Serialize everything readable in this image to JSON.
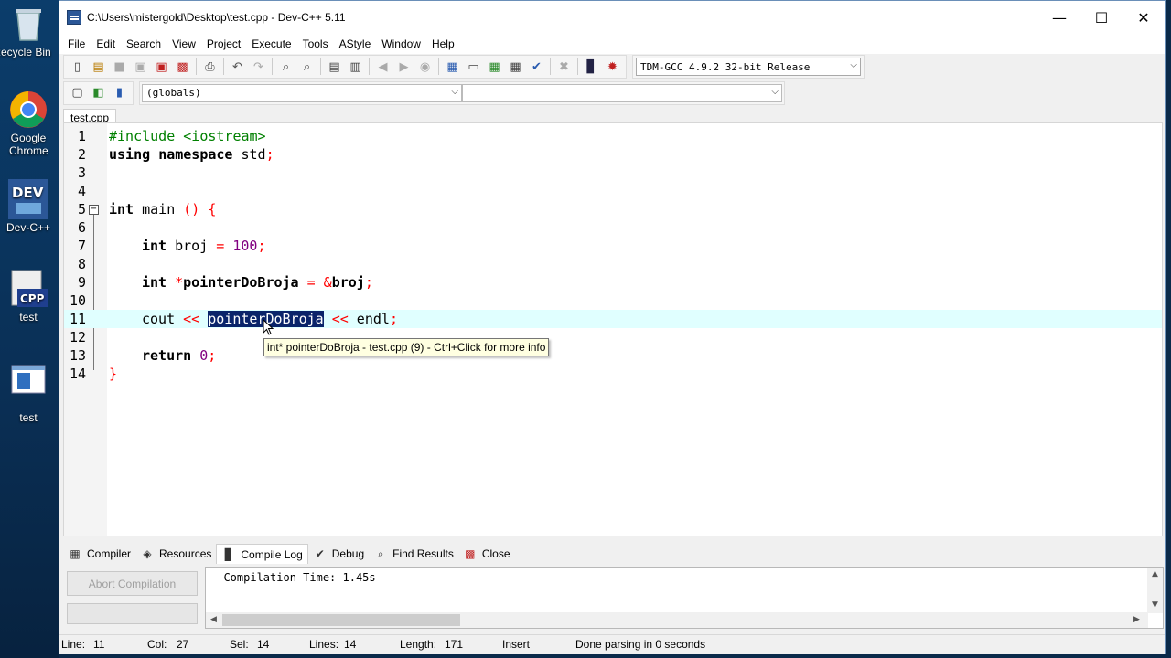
{
  "desktop": {
    "icons": [
      {
        "label": "Recycle Bin"
      },
      {
        "label": "Google Chrome"
      },
      {
        "label": "Dev-C++"
      },
      {
        "label": "test"
      },
      {
        "label": "test"
      }
    ]
  },
  "window": {
    "title": "C:\\Users\\mistergold\\Desktop\\test.cpp - Dev-C++ 5.11",
    "controls": {
      "minimize": "—",
      "maximize": "☐",
      "close": "✕"
    }
  },
  "menu": [
    "File",
    "Edit",
    "Search",
    "View",
    "Project",
    "Execute",
    "Tools",
    "AStyle",
    "Window",
    "Help"
  ],
  "toolbar": {
    "compiler_select": "TDM-GCC 4.9.2 32-bit Release",
    "scope_select": "(globals)",
    "member_select": ""
  },
  "file_tab": "test.cpp",
  "editor": {
    "line_numbers": [
      "1",
      "2",
      "3",
      "4",
      "5",
      "6",
      "7",
      "8",
      "9",
      "10",
      "11",
      "12",
      "13",
      "14"
    ],
    "line1": {
      "pp": "#include <iostream>"
    },
    "line2": {
      "kw1": "using",
      "kw2": "namespace",
      "txt": " std",
      "sym": ";"
    },
    "line5": {
      "kw": "int",
      "txt": " main ",
      "sym": "() {"
    },
    "line7": {
      "kw": "int",
      "txt": " broj ",
      "sym1": "=",
      "num": " 100",
      "sym2": ";"
    },
    "line9": {
      "kw": "int",
      "sym1": " *",
      "txt": "pointerDoBroja ",
      "sym2": "= &",
      "txt2": "broj",
      "sym3": ";"
    },
    "line11": {
      "txt1": "cout ",
      "sym1": "<<",
      "txt2": " ",
      "selected": "pointerDoBroja",
      "sym2": " <<",
      "txt3": " endl",
      "sym3": ";"
    },
    "line13": {
      "kw": "return",
      "num": " 0",
      "sym": ";"
    },
    "line14": {
      "sym": "}"
    },
    "tooltip": "int* pointerDoBroja - test.cpp (9) - Ctrl+Click for more info"
  },
  "bottom_tabs": [
    "Compiler",
    "Resources",
    "Compile Log",
    "Debug",
    "Find Results",
    "Close"
  ],
  "abort_label": "Abort Compilation",
  "log_text": "- Compilation Time: 1.45s",
  "status": {
    "line_label": "Line:",
    "line_val": "11",
    "col_label": "Col:",
    "col_val": "27",
    "sel_label": "Sel:",
    "sel_val": "14",
    "lines_label": "Lines:",
    "lines_val": "14",
    "length_label": "Length:",
    "length_val": "171",
    "mode": "Insert",
    "message": "Done parsing in 0 seconds"
  }
}
